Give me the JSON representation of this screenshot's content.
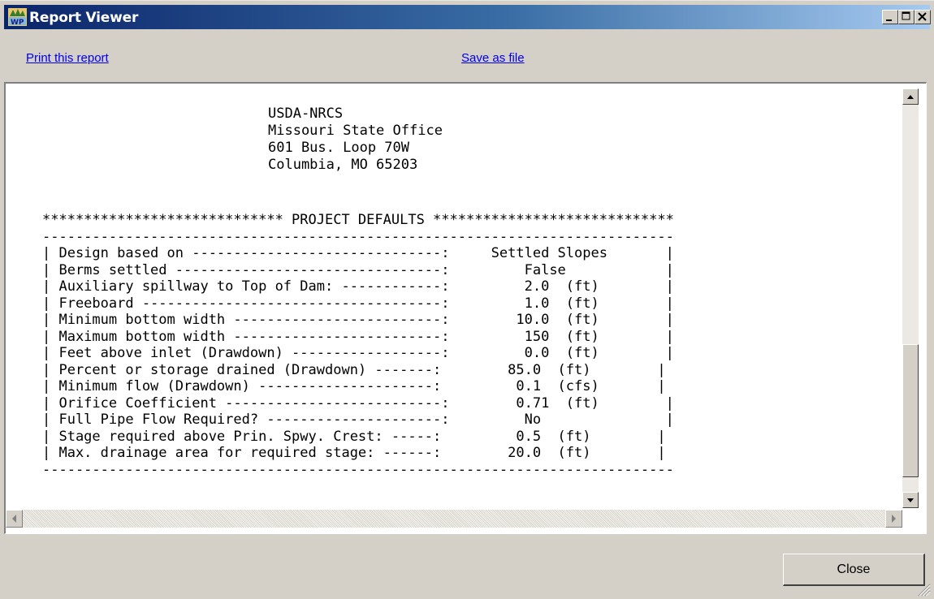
{
  "window": {
    "title": "Report Viewer",
    "app_icon": "wp-app-icon",
    "controls": [
      "minimize-icon",
      "maximize-icon",
      "close-icon"
    ]
  },
  "links": {
    "print": "Print this report",
    "save": "Save as file"
  },
  "report": {
    "address": "USDA-NRCS\nMissouri State Office\n601 Bus. Loop 70W\nColumbia, MO 65203",
    "defaults_text": "***************************** PROJECT DEFAULTS *****************************\n----------------------------------------------------------------------------\n| Design based on ------------------------------:     Settled Slopes       |\n| Berms settled --------------------------------:         False            |\n| Auxiliary spillway to Top of Dam: ------------:         2.0  (ft)        |\n| Freeboard ------------------------------------:         1.0  (ft)        |\n| Minimum bottom width -------------------------:        10.0  (ft)        |\n| Maximum bottom width -------------------------:         150  (ft)        |\n| Feet above inlet (Drawdown) ------------------:         0.0  (ft)        |\n| Percent or storage drained (Drawdown) -------:        85.0  (ft)        |\n| Minimum flow (Drawdown) ---------------------:         0.1  (cfs)       |\n| Orifice Coefficient --------------------------:        0.71  (ft)        |\n| Full Pipe Flow Required? ---------------------:         No               |\n| Stage required above Prin. Spwy. Crest: -----:         0.5  (ft)        |\n| Max. drainage area for required stage: ------:        20.0  (ft)        |\n----------------------------------------------------------------------------"
  },
  "buttons": {
    "close": "Close"
  },
  "colors": {
    "title_start": "#0a246a",
    "title_end": "#a6caf0",
    "link": "#0000ee",
    "face": "#d4d0c8"
  }
}
